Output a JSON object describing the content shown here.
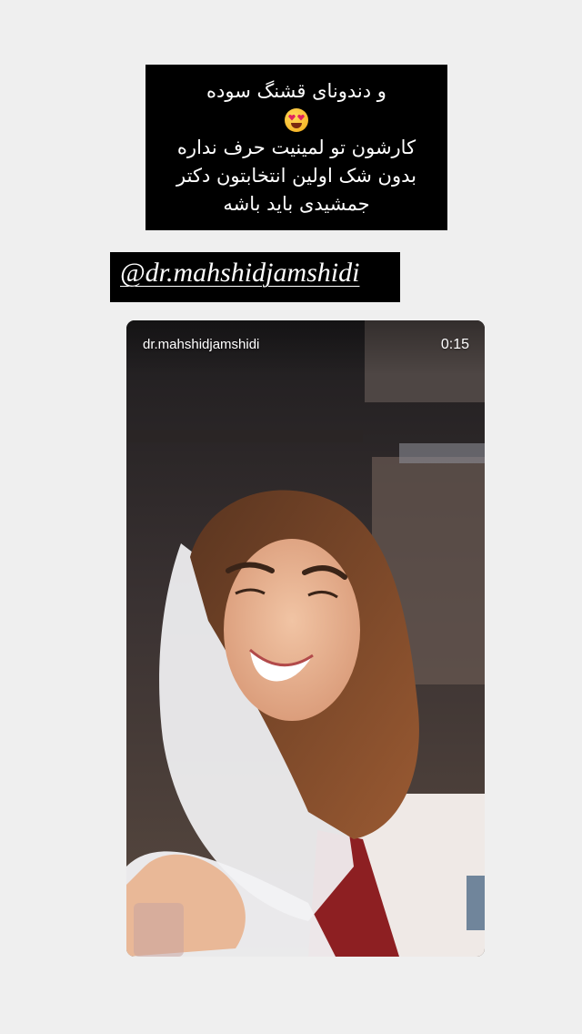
{
  "caption": {
    "lines": [
      "و دندونای قشنگ سوده",
      "کارشون تو لمینیت حرف نداره",
      "بدون شک اولین انتخابتون دکتر",
      "جمشیدی باید باشه"
    ],
    "emoji": "heart-eyes-emoji"
  },
  "mention": {
    "text": "@dr.mahshidjamshidi"
  },
  "video": {
    "username": "dr.mahshidjamshidi",
    "duration": "0:15"
  }
}
